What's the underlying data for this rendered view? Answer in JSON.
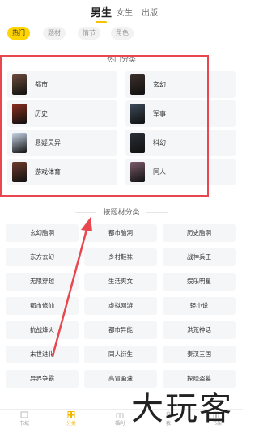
{
  "top_tabs": [
    "男生",
    "女生",
    "出版"
  ],
  "filters": [
    "热门",
    "题材",
    "情节",
    "角色"
  ],
  "hot_section_title": "热门分类",
  "hot_categories": [
    {
      "label": "都市",
      "color": "#6b4a3a"
    },
    {
      "label": "玄幻",
      "color": "#3b2f2a"
    },
    {
      "label": "历史",
      "color": "#8b2f1f"
    },
    {
      "label": "军事",
      "color": "#3c4a5a"
    },
    {
      "label": "悬疑灵异",
      "color": "#c9d6e8"
    },
    {
      "label": "科幻",
      "color": "#2a3038"
    },
    {
      "label": "游戏体育",
      "color": "#6e3b2d"
    },
    {
      "label": "同人",
      "color": "#7a5a6a"
    }
  ],
  "theme_section_title": "按题材分类",
  "themes": [
    "玄幻脑洞",
    "都市脑洞",
    "历史脑洞",
    "东方玄幻",
    "乡村鞋袜",
    "战神兵王",
    "无限穿越",
    "生活爽文",
    "娱乐明星",
    "都市修仙",
    "虚拟网游",
    "轻小说",
    "抗战烽火",
    "都市异能",
    "洪荒神话",
    "末世进化",
    "同人衍生",
    "秦汉三国",
    "异界争霸",
    "高冒画速",
    "探险盗墓"
  ],
  "bottom_nav": [
    "书城",
    "分类",
    "福利",
    "我",
    "书架"
  ],
  "watermark": "大玩客",
  "colors": {
    "accent": "#ffd400",
    "highlight_box": "#e8474f",
    "arrow": "#e8474f"
  }
}
